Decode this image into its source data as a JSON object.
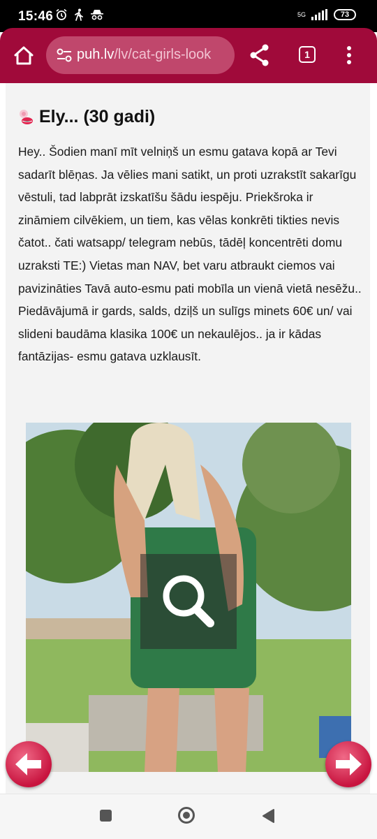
{
  "status_bar": {
    "time": "15:46",
    "network": "5G",
    "battery": "73"
  },
  "browser": {
    "url_host": "puh.lv",
    "url_path": "/lv/cat-girls-look",
    "tab_count": "1"
  },
  "listing": {
    "title": "Ely... (30 gadi)",
    "description": "Hey.. Šodien manī mīt velniņš un esmu gatava kopā ar Tevi sadarīt blēņas. Ja vēlies mani satikt, un proti uzrakstīt sakarīgu vēstuli, tad labprāt izskatīšu šādu iespēju. Priekšroka ir zināmiem cilvēkiem, un tiem, kas vēlas konkrēti tikties nevis čatot.. čati watsapp/ telegram nebūs, tādēļ koncentrēti domu uzraksti TE:) Vietas man NAV, bet varu atbraukt ciemos vai pavizināties Tavā auto-esmu pati mobīla un vienā vietā nesēžu.. Piedāvājumā ir gards, salds, dziļš un sulīgs minets 60€ un/ vai slideni baudāma klasika 100€ un nekaulējos.. ja ir kādas fantāzijas- esmu gatava uzklausīt."
  },
  "colors": {
    "toolbar": "#a00a3a",
    "url_bar": "#c0476c",
    "nav_arrow": "#d81b4a"
  },
  "icons": {
    "home": "home-icon",
    "site_settings": "tune-icon",
    "share": "share-icon",
    "menu": "more-vert-icon",
    "zoom": "magnifier-icon",
    "prev": "arrow-left-icon",
    "next": "arrow-right-icon"
  }
}
